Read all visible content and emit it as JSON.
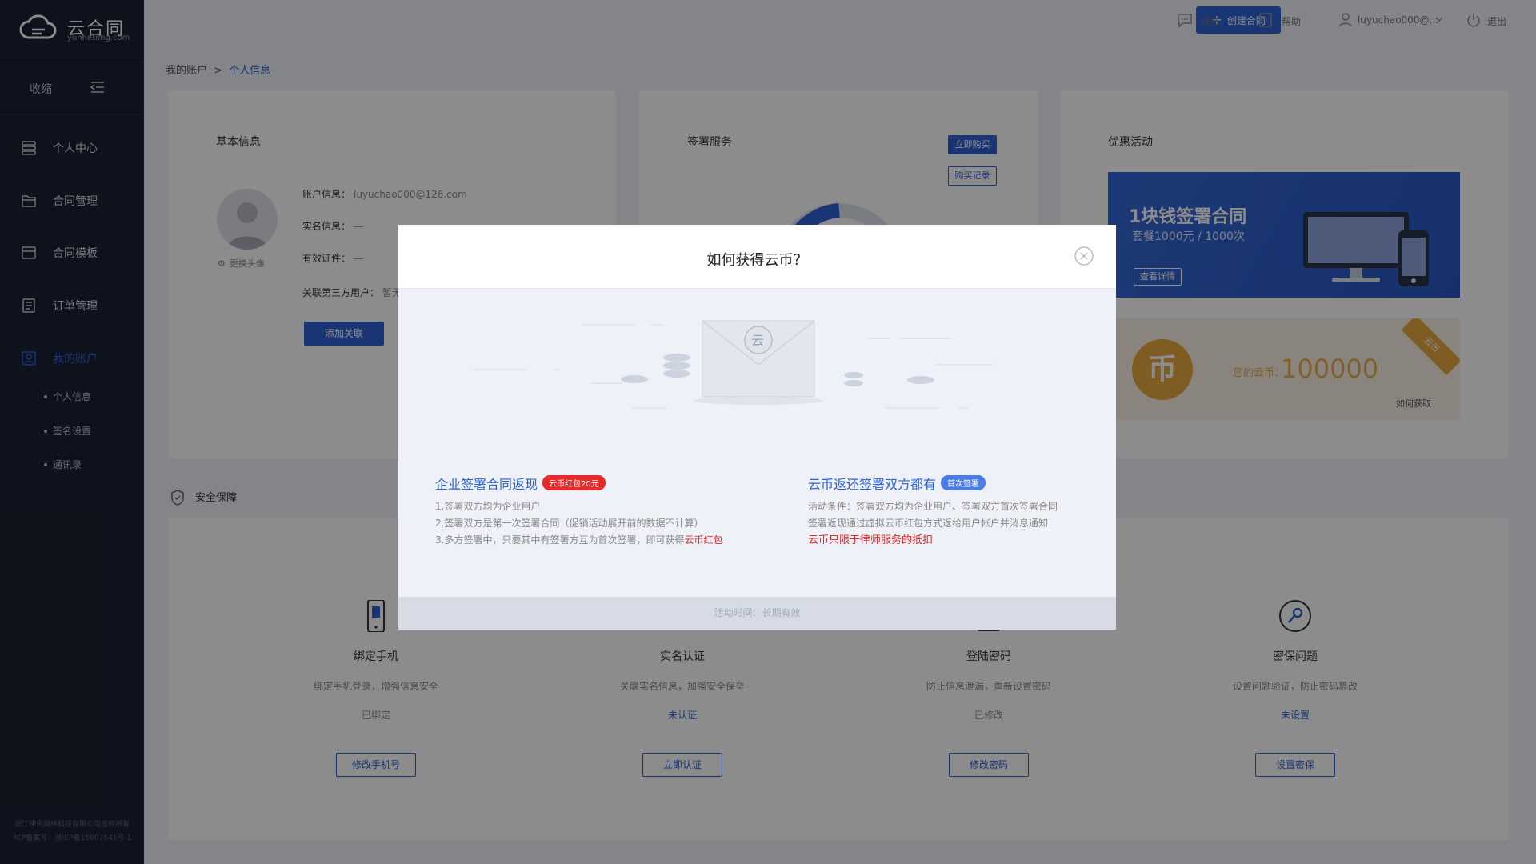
{
  "app": {
    "logo_name": "云合同",
    "logo_sub": "yunhetong.com"
  },
  "sidebar": {
    "collapse_label": "收缩",
    "items": [
      {
        "label": "个人中心",
        "icon": "layers-icon"
      },
      {
        "label": "合同管理",
        "icon": "folder-icon"
      },
      {
        "label": "合同模板",
        "icon": "template-icon"
      },
      {
        "label": "订单管理",
        "icon": "order-icon"
      },
      {
        "label": "我的账户",
        "icon": "account-icon",
        "active": true
      }
    ],
    "subitems": [
      "个人信息",
      "签名设置",
      "通讯录"
    ],
    "copyright": [
      "浙江律讯网络科技有限公司版权所有",
      "ICP备案号：浙ICP备15007541号-1"
    ]
  },
  "topbar": {
    "create_label": "创建合同",
    "messages_label": "消息",
    "help_label": "帮助",
    "user_label": "luyuchao000@...",
    "logout_label": "退出"
  },
  "breadcrumb": {
    "parent": "我的账户",
    "separator": ">",
    "current": "个人信息"
  },
  "basic_info": {
    "title": "基本信息",
    "change_avatar": "更换头像",
    "account_label": "账户信息：",
    "account_value": "luyuchao000@126.com",
    "realname_label": "实名信息：",
    "realname_value": "—",
    "cert_label": "有效证件：",
    "cert_value": "—",
    "third_label": "关联第三方用户：",
    "third_value": "暂无",
    "add_link_label": "添加关联"
  },
  "sign_service": {
    "title": "签署服务",
    "buy_now": "立即购买",
    "buy_record": "购买记录"
  },
  "promotions": {
    "title": "优惠活动",
    "banner_title": "1块钱签署合同",
    "banner_sub": "套餐1000元 / 1000次",
    "banner_btn": "查看详情",
    "coin_label": "您的云币：",
    "coin_value": "100000",
    "coin_how": "如何获取",
    "coin_ribbon": "云币",
    "coin_glyph": "币"
  },
  "security": {
    "title": "安全保障",
    "items": [
      {
        "title": "绑定手机",
        "desc": "绑定手机登录，增强信息安全",
        "status": "已绑定",
        "status_color": "#888888",
        "action": "修改手机号",
        "icon": "phone-icon"
      },
      {
        "title": "实名认证",
        "desc": "关联实名信息，加强安全保垒",
        "status": "未认证",
        "status_color": "#2f62d3",
        "action": "立即认证",
        "icon": "id-card-icon"
      },
      {
        "title": "登陆密码",
        "desc": "防止信息泄漏，重新设置密码",
        "status": "已修改",
        "status_color": "#888888",
        "action": "修改密码",
        "icon": "lock-icon"
      },
      {
        "title": "密保问题",
        "desc": "设置问题验证，防止密码篡改",
        "status": "未设置",
        "status_color": "#2f62d3",
        "action": "设置密保",
        "icon": "key-icon"
      }
    ]
  },
  "modal": {
    "title": "如何获得云币？",
    "envelope_glyph": "云",
    "left": {
      "title": "企业签署合同返现",
      "badge": "云币红包20元",
      "line1": "1.签署双方均为企业用户",
      "line2": "2.签署双方是第一次签署合同（促销活动展开前的数据不计算）",
      "line3_prefix": "3.多方签署中，只要其中有签署方互为首次签署，即可获得",
      "line3_highlight": "云币红包"
    },
    "right": {
      "title": "云币返还签署双方都有",
      "badge": "首次签署",
      "line1": "活动条件：签署双方均为企业用户、签署双方首次签署合同",
      "line2": "签署返现通过虚拟云币红包方式返给用户帐户并消息通知",
      "line3": "云币只限于律师服务的抵扣"
    },
    "footer": "活动时间：长期有效"
  },
  "colors": {
    "primary": "#2f62d3",
    "sidebar": "#1a2233",
    "gold": "#e8b052",
    "red": "#e62929"
  }
}
